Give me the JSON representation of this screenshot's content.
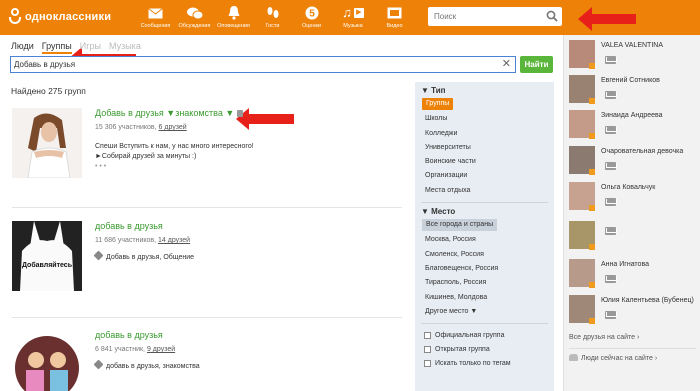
{
  "brand": {
    "name": "одноклассники",
    "accent": "#ee8208",
    "green": "#5ab63a"
  },
  "nav": [
    {
      "label": "Сообщения",
      "icon": "envelope-icon"
    },
    {
      "label": "Обсуждения",
      "icon": "chat-icon"
    },
    {
      "label": "Оповещения",
      "icon": "bell-icon"
    },
    {
      "label": "Гости",
      "icon": "footprints-icon"
    },
    {
      "label": "Оценки",
      "icon": "rating-icon",
      "badge": "5"
    },
    {
      "label": "Музыка",
      "icon": "music-icon"
    },
    {
      "label": "Видео",
      "icon": "video-icon"
    }
  ],
  "top_search": {
    "placeholder": "Поиск"
  },
  "tabs": {
    "people": "Люди",
    "groups": "Группы",
    "more1": "Игры",
    "more2": "Музыка"
  },
  "search": {
    "value": "Добавь в друзья",
    "button": "Найти"
  },
  "found": "Найдено 275 групп",
  "groups": [
    {
      "title": "Добавь в друзья",
      "title_suffix": "знакомства",
      "members": "15 306 участников,",
      "friends": "6 друзей",
      "desc1": "Спеши Вступить к нам, у нас много интересного!",
      "desc2": "►Собирай друзей за минуты :)",
      "desc3": "• • •"
    },
    {
      "title": "добавь в друзья",
      "members": "11 686 участников,",
      "friends": "14 друзей",
      "tags": "Добавь в друзья,  Общение",
      "photo_text": "Добавляйтесь"
    },
    {
      "title": "добавь в друзья",
      "members": "6 841 участник,",
      "friends": "9 друзей",
      "tags": "добавь в друзья,  знакомства"
    }
  ],
  "filters": {
    "type_head": "Тип",
    "types": [
      "Группы",
      "Школы",
      "Колледжи",
      "Университеты",
      "Воинские части",
      "Организации",
      "Места отдыха"
    ],
    "place_head": "Место",
    "places": [
      "Все города и страны",
      "Москва, Россия",
      "Смоленск, Россия",
      "Благовещенск, Россия",
      "Тирасполь, Россия",
      "Кишинев, Молдова",
      "Другое место ▼"
    ],
    "checks": [
      "Официальная группа",
      "Открытая группа",
      "Искать только по тегам"
    ]
  },
  "friends": [
    {
      "name": "VALEA VALENTINA"
    },
    {
      "name": "Евгений Сотников"
    },
    {
      "name": "Зинаида Андреева"
    },
    {
      "name": "Очаровательная девочка"
    },
    {
      "name": "Ольга Ковальчук"
    },
    {
      "name": ""
    },
    {
      "name": "Анна Игнатова"
    },
    {
      "name": "Юлия Калентьева (Бубенец)"
    }
  ],
  "right_links": {
    "all_friends": "Все друзья на сайте ›",
    "now_online": "Люди сейчас на сайте ›"
  }
}
